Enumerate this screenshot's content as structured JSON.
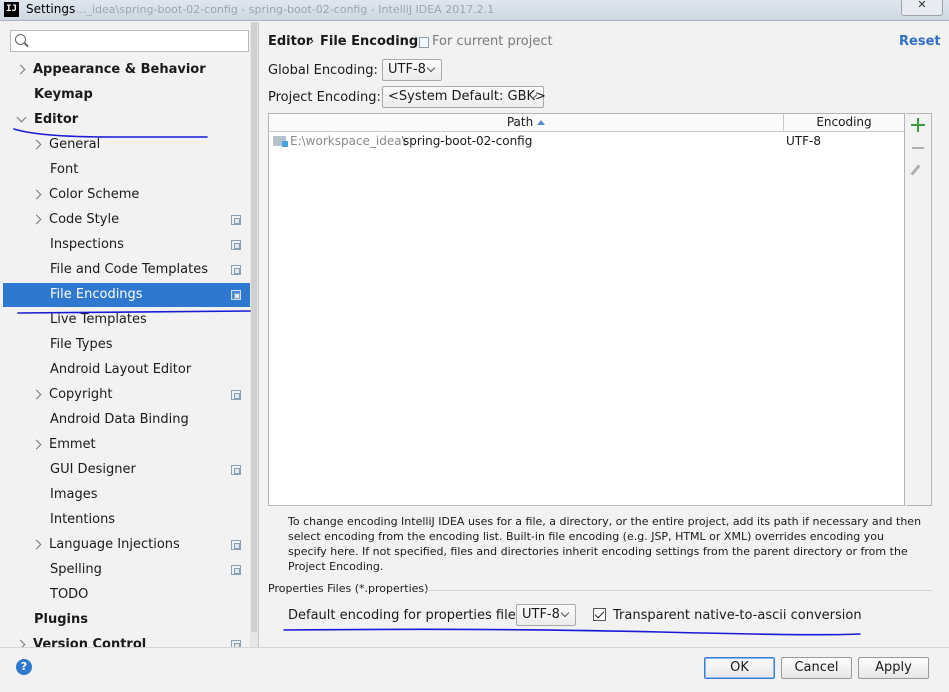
{
  "window": {
    "app_icon": "IJ",
    "title": "Settings",
    "faded_title": "..._idea\\spring-boot-02-config - spring-boot-02-config - IntelliJ IDEA 2017.2.1",
    "close_label": "✕"
  },
  "sidebar": {
    "search_placeholder": "",
    "items": [
      {
        "label": "Appearance & Behavior"
      },
      {
        "label": "Keymap"
      },
      {
        "label": "Editor"
      },
      {
        "label": "General"
      },
      {
        "label": "Font"
      },
      {
        "label": "Color Scheme"
      },
      {
        "label": "Code Style"
      },
      {
        "label": "Inspections"
      },
      {
        "label": "File and Code Templates"
      },
      {
        "label": "File Encodings"
      },
      {
        "label": "Live Templates"
      },
      {
        "label": "File Types"
      },
      {
        "label": "Android Layout Editor"
      },
      {
        "label": "Copyright"
      },
      {
        "label": "Android Data Binding"
      },
      {
        "label": "Emmet"
      },
      {
        "label": "GUI Designer"
      },
      {
        "label": "Images"
      },
      {
        "label": "Intentions"
      },
      {
        "label": "Language Injections"
      },
      {
        "label": "Spelling"
      },
      {
        "label": "TODO"
      },
      {
        "label": "Plugins"
      },
      {
        "label": "Version Control"
      }
    ]
  },
  "main": {
    "breadcrumb_parent": "Editor",
    "breadcrumb_sep": "›",
    "breadcrumb_current": "File Encodings",
    "scope_note": "For current project",
    "reset_label": "Reset",
    "global_encoding_label": "Global Encoding:",
    "global_encoding_value": "UTF-8",
    "project_encoding_label": "Project Encoding:",
    "project_encoding_value": "<System Default: GBK>",
    "table": {
      "col_path": "Path",
      "col_encoding": "Encoding",
      "rows": [
        {
          "path_prefix": "E:\\workspace_idea\\",
          "path_name": "spring-boot-02-config",
          "encoding": "UTF-8"
        }
      ]
    },
    "help_text": "To change encoding IntelliJ IDEA uses for a file, a directory, or the entire project, add its path if necessary and then select encoding from the encoding list. Built-in file encoding (e.g. JSP, HTML or XML) overrides encoding you specify here. If not specified, files and directories inherit encoding settings from the parent directory or from the Project Encoding.",
    "properties_section_title": "Properties Files (*.properties)",
    "default_props_label": "Default encoding for properties files:",
    "default_props_value": "UTF-8",
    "native_ascii_label": "Transparent native-to-ascii conversion",
    "native_ascii_checked": true
  },
  "footer": {
    "help_label": "?",
    "ok_label": "OK",
    "cancel_label": "Cancel",
    "apply_label": "Apply"
  },
  "colors": {
    "selection": "#2f78d0",
    "link": "#2e6fc4",
    "annotation_ink": "#1a1ad6",
    "add_green": "#3c9b3c"
  }
}
